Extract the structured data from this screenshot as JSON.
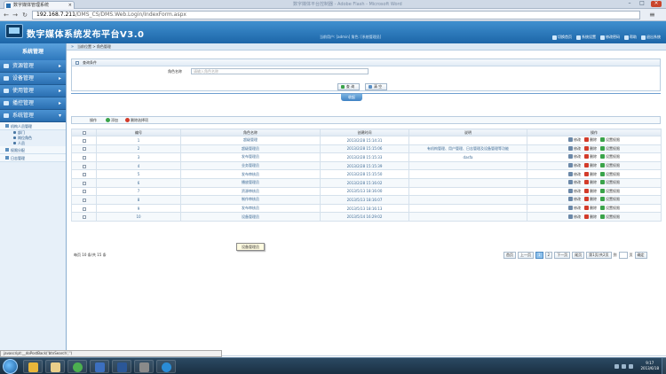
{
  "browser": {
    "tab_title": "数字媒体管理系统",
    "window_title": "数字媒体平台控制器 - Adobe Flash - Microsoft Word",
    "url_host": "192.168.7.211",
    "url_path": "/DMS_CS/DMS.Web.Login/IndexForm.aspx",
    "status_text": "javascript:__doPostBack('btnSearch','')"
  },
  "app": {
    "title": "数字媒体系统发布平台V3.0",
    "user_info": "当前用户: [admin] 角色: [系统管理员]",
    "top_links": [
      "切换首页",
      "系统设置",
      "修改密码",
      "帮助",
      "退出系统"
    ]
  },
  "breadcrumb": {
    "prefix": "当前位置",
    "sep": ">",
    "page": "角色管理"
  },
  "sidebar": {
    "title": "系统管理",
    "items": [
      {
        "label": "资源管理"
      },
      {
        "label": "设备管理"
      },
      {
        "label": "使用管理"
      },
      {
        "label": "播控管理"
      },
      {
        "label": "系统管理"
      }
    ],
    "groups": [
      {
        "label": "机构人员管理",
        "leaves": [
          "部门",
          "岗位角色",
          "人员"
        ]
      },
      {
        "label": "权限分配",
        "leaves": []
      },
      {
        "label": "日志管理",
        "leaves": []
      }
    ]
  },
  "query": {
    "title": "查询条件",
    "name_label": "角色名称",
    "name_placeholder": "请输入角色名称",
    "search_label": "查 询",
    "reset_label": "清 空",
    "fold_label": "收起"
  },
  "ops": {
    "label": "操作",
    "add_label": "添加",
    "delete_selected_label": "删除选择项"
  },
  "table": {
    "headers": [
      "",
      "编号",
      "角色名称",
      "创建时间",
      "说明",
      "操作"
    ],
    "row_actions": [
      "修改",
      "删除",
      "设置权限"
    ],
    "rows": [
      {
        "no": "1",
        "name": "超级管理",
        "time": "2013/2/28 15:14:31",
        "desc": ""
      },
      {
        "no": "2",
        "name": "超级管理员",
        "time": "2013/2/28 15:15:06",
        "desc": "有机构管理、用户管理、日志管理及设备管理等功能"
      },
      {
        "no": "3",
        "name": "发布管理员",
        "time": "2013/2/28 15:15:33",
        "desc": "dasfa"
      },
      {
        "no": "4",
        "name": "业务管理员",
        "time": "2013/2/28 15:15:39",
        "desc": ""
      },
      {
        "no": "5",
        "name": "发布审核员",
        "time": "2013/2/28 15:15:50",
        "desc": ""
      },
      {
        "no": "6",
        "name": "播放管理员",
        "time": "2013/2/28 15:16:02",
        "desc": ""
      },
      {
        "no": "7",
        "name": "资源审核员",
        "time": "2013/5/13 18:16:00",
        "desc": ""
      },
      {
        "no": "8",
        "name": "制作审核员",
        "time": "2013/5/13 18:16:07",
        "desc": ""
      },
      {
        "no": "9",
        "name": "发布审核员",
        "time": "2013/5/13 18:16:13",
        "desc": ""
      },
      {
        "no": "10",
        "name": "设备管理员",
        "time": "2013/5/14 16:29:02",
        "desc": ""
      }
    ],
    "tooltip": "设备管理员"
  },
  "pagination": {
    "info": "每页 10 条/共 15 条",
    "first": "首页",
    "prev": "上一页",
    "pages": [
      "1",
      "2"
    ],
    "current": "1",
    "next": "下一页",
    "last": "尾页",
    "summary": "第1页/共2页",
    "goto_label": "到",
    "page_unit": "页",
    "confirm": "确定"
  },
  "taskbar": {
    "time": "9:17",
    "date": "2013/6/18"
  },
  "colors": {
    "header_blue": "#1d66a8",
    "sidebar_blue": "#2a6fb1",
    "link_blue": "#3d6a95",
    "close_red": "#c9462c"
  }
}
